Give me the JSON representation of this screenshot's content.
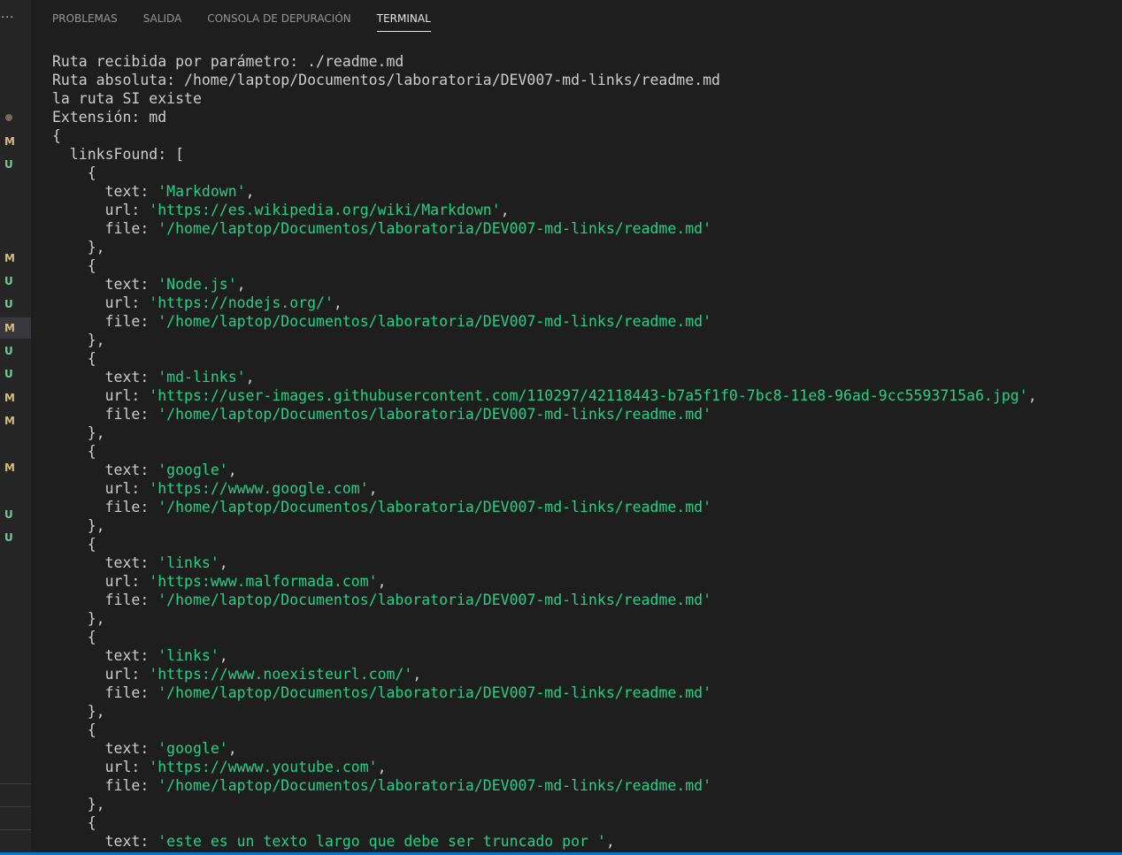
{
  "gutter": {
    "overflow_glyph": "...",
    "badges": [
      "M",
      "U",
      "M",
      "U",
      "U",
      "M",
      "U",
      "U",
      "M",
      "M",
      "M",
      "U",
      "U"
    ]
  },
  "tabs": [
    {
      "label": "PROBLEMAS",
      "active": false
    },
    {
      "label": "SALIDA",
      "active": false
    },
    {
      "label": "CONSOLA DE DEPURACIÓN",
      "active": false
    },
    {
      "label": "TERMINAL",
      "active": true
    }
  ],
  "terminal": {
    "header_lines": [
      "Ruta recibida por parámetro: ./readme.md",
      "Ruta absoluta: /home/laptop/Documentos/laboratoria/DEV007-md-links/readme.md",
      "la ruta SI existe",
      "Extensión: md",
      "{",
      "  linksFound: ["
    ],
    "links": [
      {
        "text": "Markdown",
        "url": "https://es.wikipedia.org/wiki/Markdown",
        "file": "/home/laptop/Documentos/laboratoria/DEV007-md-links/readme.md"
      },
      {
        "text": "Node.js",
        "url": "https://nodejs.org/",
        "file": "/home/laptop/Documentos/laboratoria/DEV007-md-links/readme.md"
      },
      {
        "text": "md-links",
        "url": "https://user-images.githubusercontent.com/110297/42118443-b7a5f1f0-7bc8-11e8-96ad-9cc5593715a6.jpg",
        "file": "/home/laptop/Documentos/laboratoria/DEV007-md-links/readme.md"
      },
      {
        "text": "google",
        "url": "https://wwww.google.com",
        "file": "/home/laptop/Documentos/laboratoria/DEV007-md-links/readme.md"
      },
      {
        "text": "links",
        "url": "https:www.malformada.com",
        "file": "/home/laptop/Documentos/laboratoria/DEV007-md-links/readme.md"
      },
      {
        "text": "links",
        "url": "https://www.noexisteurl.com/",
        "file": "/home/laptop/Documentos/laboratoria/DEV007-md-links/readme.md"
      },
      {
        "text": "google",
        "url": "https://wwww.youtube.com",
        "file": "/home/laptop/Documentos/laboratoria/DEV007-md-links/readme.md"
      }
    ],
    "last_open": {
      "text": "este es un texto largo que debe ser truncado por "
    }
  },
  "colors": {
    "background": "#1e1e1e",
    "foreground": "#cccccc",
    "string": "#23d18b",
    "modified_badge": "#d7ba7d",
    "untracked_badge": "#73c991",
    "status_bar": "#007acc"
  }
}
